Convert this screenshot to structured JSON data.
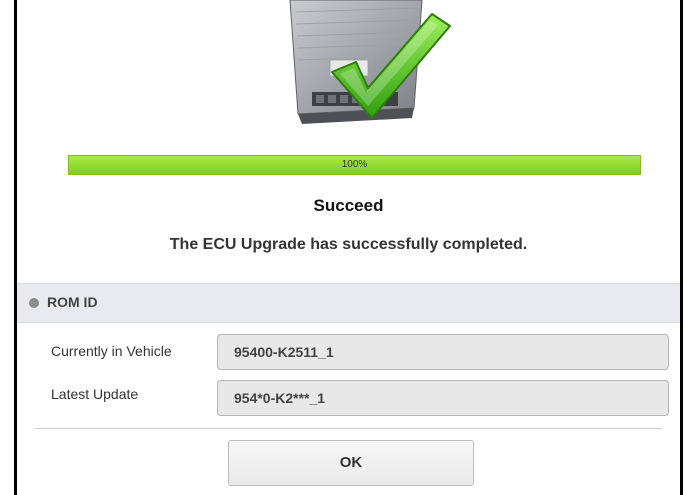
{
  "progress": {
    "value_percent": 100,
    "label": "100%"
  },
  "status": {
    "title": "Succeed",
    "message": "The ECU Upgrade has successfully completed."
  },
  "rom_section": {
    "label": "ROM ID",
    "rows": [
      {
        "label": "Currently in Vehicle",
        "value": "95400-K2511_1"
      },
      {
        "label": "Latest Update",
        "value": "954*0-K2***_1"
      }
    ]
  },
  "actions": {
    "ok_label": "OK"
  },
  "icons": {
    "hero": "ecu-module-with-checkmark-icon",
    "section_bullet": "bullet-dot-icon"
  },
  "colors": {
    "progress_fill": "#7ece1c",
    "check_green": "#4caf18",
    "section_background": "#e7ebef"
  }
}
